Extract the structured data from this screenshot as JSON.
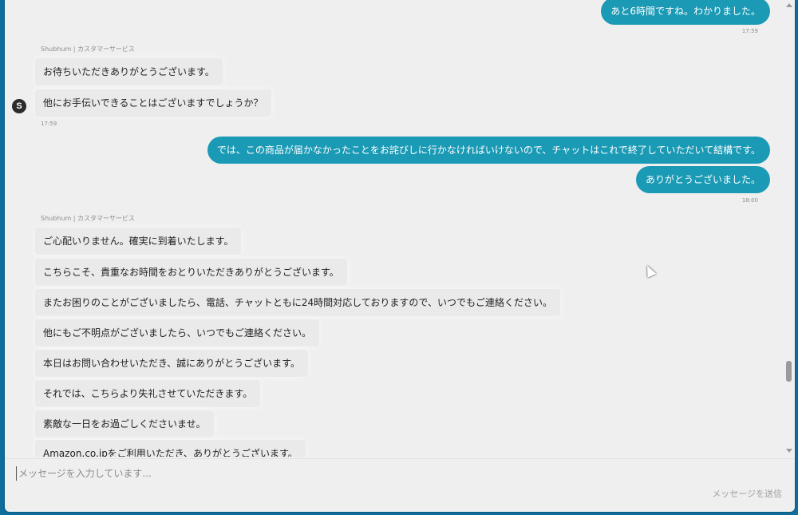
{
  "messages_top": {
    "out_1": "あと6時間ですね。わかりました。",
    "time_1": "17:59"
  },
  "block_1": {
    "sender": "Shubhum | カスタマーサービス",
    "avatar_letter": "S",
    "msgs": [
      "お待ちいただきありがとうございます。",
      "他にお手伝いできることはございますでしょうか？"
    ],
    "time": "17:59"
  },
  "block_2": {
    "msgs": [
      "では、この商品が届かなかったことをお詫びしに行かなければいけないので、チャットはこれで終了していただいて結構です。",
      "ありがとうございました。"
    ],
    "time": "18:00"
  },
  "block_3": {
    "sender": "Shubhum | カスタマーサービス",
    "msgs": [
      "ご心配いりません。確実に到着いたします。",
      "こちらこそ、貴重なお時間をおとりいただきありがとうございます。",
      "またお困りのことがございましたら、電話、チャットともに24時間対応しておりますので、いつでもご連絡ください。",
      "他にもご不明点がございましたら、いつでもご連絡ください。",
      "本日はお問い合わせいただき、誠にありがとうございます。",
      "それでは、こちらより失礼させていただきます。",
      "素敵な一日をお過ごしくださいませ。",
      "Amazon.co.jpをご利用いただき、ありがとうございます。"
    ]
  },
  "composer": {
    "placeholder": "メッセージを入力しています...",
    "send_label": "メッセージを送信"
  },
  "colors": {
    "outgoing_bubble": "#1b9ab5",
    "background": "#efefef"
  }
}
